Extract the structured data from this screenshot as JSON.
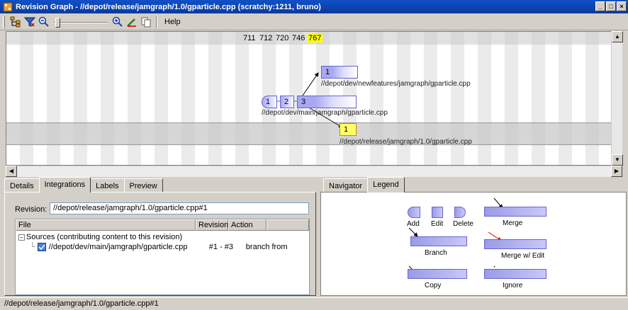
{
  "window": {
    "title": "Revision Graph - //depot/release/jamgraph/1.0/gparticle.cpp (scratchy:1211, bruno)",
    "minimize": "_",
    "maximize": "□",
    "close": "×"
  },
  "toolbar": {
    "help_label": "Help",
    "icons": [
      "tree-icon",
      "filter-icon",
      "zoom-out-icon",
      "zoom-slider",
      "zoom-in-icon",
      "highlight-icon",
      "copy-icon"
    ]
  },
  "graph": {
    "changelists": [
      "711",
      "712",
      "720",
      "746",
      "767"
    ],
    "highlighted_changelist": "767",
    "nodes": {
      "newfeatures_rev": "1",
      "main_rev1": "1",
      "main_rev2": "2",
      "main_rev3": "3",
      "release_rev": "1"
    },
    "paths": {
      "newfeatures": "//depot/dev/newfeatures/jamgraph/gparticle.cpp",
      "main": "//depot/dev/main/jamgraph/gparticle.cpp",
      "release": "//depot/release/jamgraph/1.0/gparticle.cpp"
    }
  },
  "details": {
    "tabs": [
      "Details",
      "Integrations",
      "Labels",
      "Preview"
    ],
    "active_tab": "Integrations",
    "revision_label": "Revision:",
    "revision_value": "//depot/release/jamgraph/1.0/gparticle.cpp#1",
    "columns": [
      "File",
      "Revision",
      "Action"
    ],
    "group_label": "Sources (contributing content to this revision)",
    "rows": [
      {
        "file": "//depot/dev/main/jamgraph/gparticle.cpp",
        "revision": "#1 - #3",
        "action": "branch from"
      }
    ]
  },
  "legend": {
    "tabs": [
      "Navigator",
      "Legend"
    ],
    "active_tab": "Legend",
    "items": {
      "add": "Add",
      "edit": "Edit",
      "delete": "Delete",
      "merge": "Merge",
      "branch": "Branch",
      "merge_edit": "Merge w/ Edit",
      "copy": "Copy",
      "ignore": "Ignore"
    }
  },
  "status": {
    "text": "//depot/release/jamgraph/1.0/gparticle.cpp#1"
  },
  "colors": {
    "title_bar": "#0a3a9a",
    "node_fill": "#a8a8f0",
    "highlight": "#ffff00",
    "merge_edit_arrow": "#cc0000"
  }
}
